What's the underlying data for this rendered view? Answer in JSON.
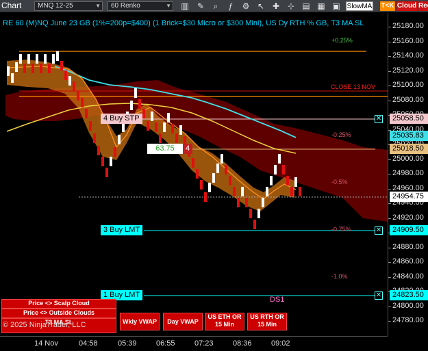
{
  "toolbar": {
    "label": "Chart",
    "instrument": "MNQ 12-25",
    "period": "60 Renko",
    "indicator_box": "SlowMA",
    "toc_box": "T<K",
    "cloud_box": "Cloud",
    "red_box": "Red"
  },
  "chart": {
    "title": "RE 60 (M)NQ June 23 GB (1%=200p=$400) (1 Brick=$30 Micro or $300 Mini), US Dy RTH % GB, T3 MA SL",
    "close_label": "CLOSE 13 NOV",
    "ds_label": "DS1",
    "copyright": "© 2025 NinjaTrader, LLC",
    "pct_labels": [
      {
        "text": "+0.25%"
      },
      {
        "text": "-0.25%"
      },
      {
        "text": "-0.5%"
      },
      {
        "text": "-0.75%"
      },
      {
        "text": "-1.0%"
      }
    ],
    "orders": {
      "buy_stp": "4 Buy STP",
      "profit": "63.75",
      "profit_qty": "4",
      "buy_lmt_3": "3 Buy LMT",
      "buy_lmt_1": "1 Buy LMT"
    },
    "buttons": {
      "scalp": "Price <> Scalp Cloud",
      "outside": "Price <> Outside Clouds",
      "t3": "T3 MA SL",
      "wkly": "Wkly VWAP",
      "day": "Day VWAP",
      "eth": "US ETH OR 15 Min",
      "rth": "US RTH OR 15 Min"
    }
  },
  "price_axis": {
    "ticks": [
      "25180.00",
      "25160.00",
      "25140.00",
      "25120.00",
      "25100.00",
      "25080.00",
      "25060.00",
      "25040.00",
      "25020.00",
      "25000.00",
      "24980.00",
      "24960.00",
      "24940.00",
      "24920.00",
      "24900.00",
      "24880.00",
      "24860.00",
      "24840.00",
      "24820.00",
      "24800.00",
      "24780.00"
    ],
    "tags": {
      "buy_stp": "25058.50",
      "ma": "25035.83",
      "avg": "25018.50",
      "last": "24954.75",
      "lmt3": "24909.50",
      "lmt1": "24823.50"
    }
  },
  "time_axis": [
    "14 Nov",
    "04:58",
    "05:39",
    "06:55",
    "07:23",
    "08:36",
    "09:02"
  ],
  "colors": {
    "up_brick": "#ffffff",
    "down_brick": "#e01010",
    "cyan_ma": "#3fe0e8",
    "yellow_ma": "#f0d040",
    "orange_cloud": "#f09020",
    "red_cloud": "#8b0000",
    "buy_stp": "#f4c7cc",
    "lmt_line": "#00ffff",
    "accent": "#ff8c00"
  }
}
